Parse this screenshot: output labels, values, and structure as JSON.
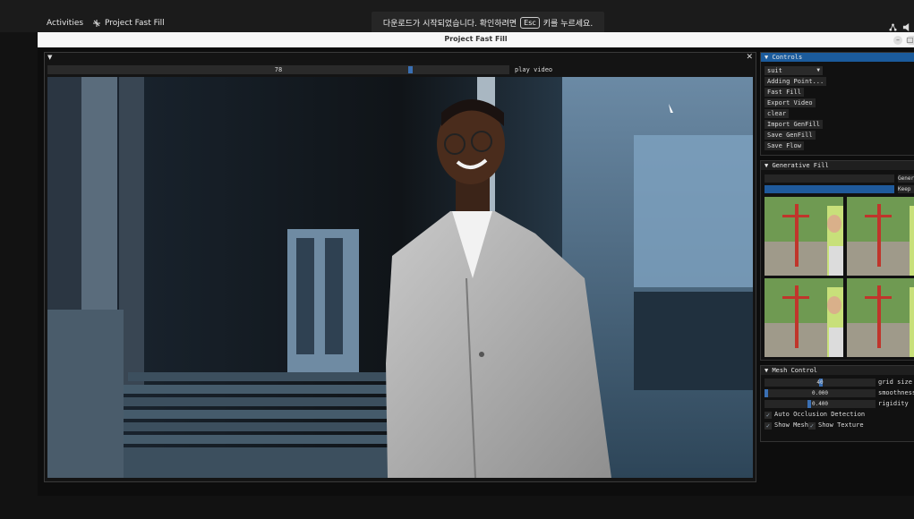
{
  "os": {
    "activities": "Activities",
    "app_name": "Project Fast Fill",
    "toast": {
      "before": "다운로드가 시작되었습니다. 확인하려면",
      "key": "Esc",
      "after": "키를 누르세요."
    }
  },
  "window": {
    "title": "Project Fast Fill"
  },
  "video_panel": {
    "frame_value": "78",
    "play_label": "play video"
  },
  "controls": {
    "header": "Controls",
    "dropdown_value": "suit",
    "buttons": [
      "Adding Point...",
      "Fast Fill",
      "Export Video",
      "clear",
      "Import GenFill",
      "Save GenFill",
      "Save Flow"
    ]
  },
  "generative_fill": {
    "header": "Generative Fill",
    "generate_label": "Generate",
    "keep_label": "Keep"
  },
  "mesh_control": {
    "header": "Mesh Control",
    "sliders": [
      {
        "value": "40",
        "label": "grid size"
      },
      {
        "value": "0.000",
        "label": "smoothness"
      },
      {
        "value": "0.400",
        "label": "rigidity"
      }
    ],
    "checkboxes": [
      "Auto Occlusion Detection",
      "Show Mesh",
      "Show Texture"
    ]
  },
  "colors": {
    "accent": "#1b5b9c",
    "slider_grab": "#3a6fb3",
    "bg": "#121212"
  }
}
